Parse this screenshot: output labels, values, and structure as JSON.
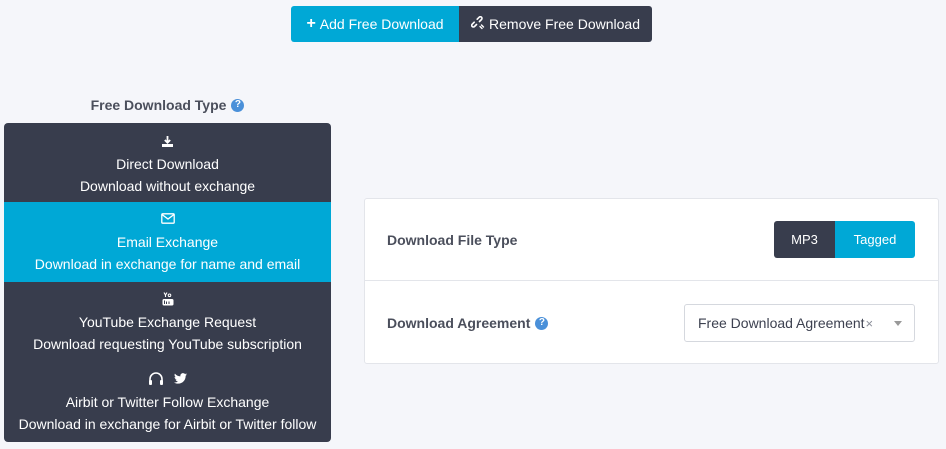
{
  "actions": {
    "add_label": "Add Free Download",
    "remove_label": "Remove Free Download"
  },
  "type_panel": {
    "title": "Free Download Type",
    "items": [
      {
        "name": "Direct Download",
        "desc": "Download without exchange",
        "icon": "download-icon",
        "active": false
      },
      {
        "name": "Email Exchange",
        "desc": "Download in exchange for name and email",
        "icon": "envelope-icon",
        "active": true
      },
      {
        "name": "YouTube Exchange Request",
        "desc": "Download requesting YouTube subscription",
        "icon": "youtube-icon",
        "active": false
      },
      {
        "name": "Airbit or Twitter Follow Exchange",
        "desc": "Download in exchange for Airbit or Twitter follow",
        "icon": "airbit-twitter-icon",
        "active": false
      }
    ]
  },
  "settings": {
    "file_type_label": "Download File Type",
    "file_type_options": [
      "MP3",
      "Tagged"
    ],
    "file_type_selected": "Tagged",
    "agreement_label": "Download Agreement",
    "agreement_value": "Free Download Agreement",
    "agreement_clear": "×"
  },
  "colors": {
    "accent": "#00a8d6",
    "dark": "#383d4d",
    "background": "#f5f6fa",
    "help": "#4a90d9"
  }
}
